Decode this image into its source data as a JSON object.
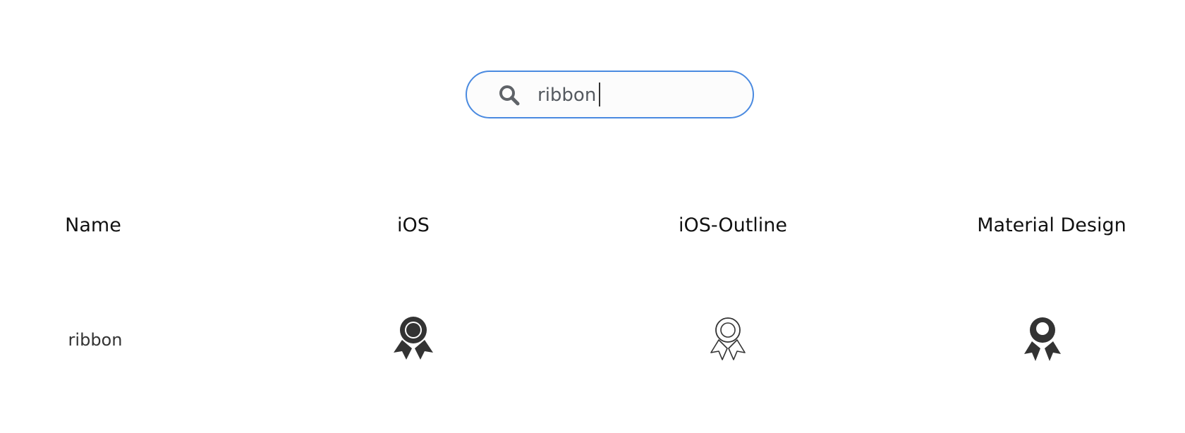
{
  "search": {
    "icon": "search-icon",
    "value": "ribbon",
    "accent_color": "#4a8ae0"
  },
  "table": {
    "headers": [
      "Name",
      "iOS",
      "iOS-Outline",
      "Material Design"
    ],
    "rows": [
      {
        "name": "ribbon",
        "icons": [
          "ribbon-filled-icon",
          "ribbon-outline-icon",
          "ribbon-material-icon"
        ]
      }
    ]
  }
}
